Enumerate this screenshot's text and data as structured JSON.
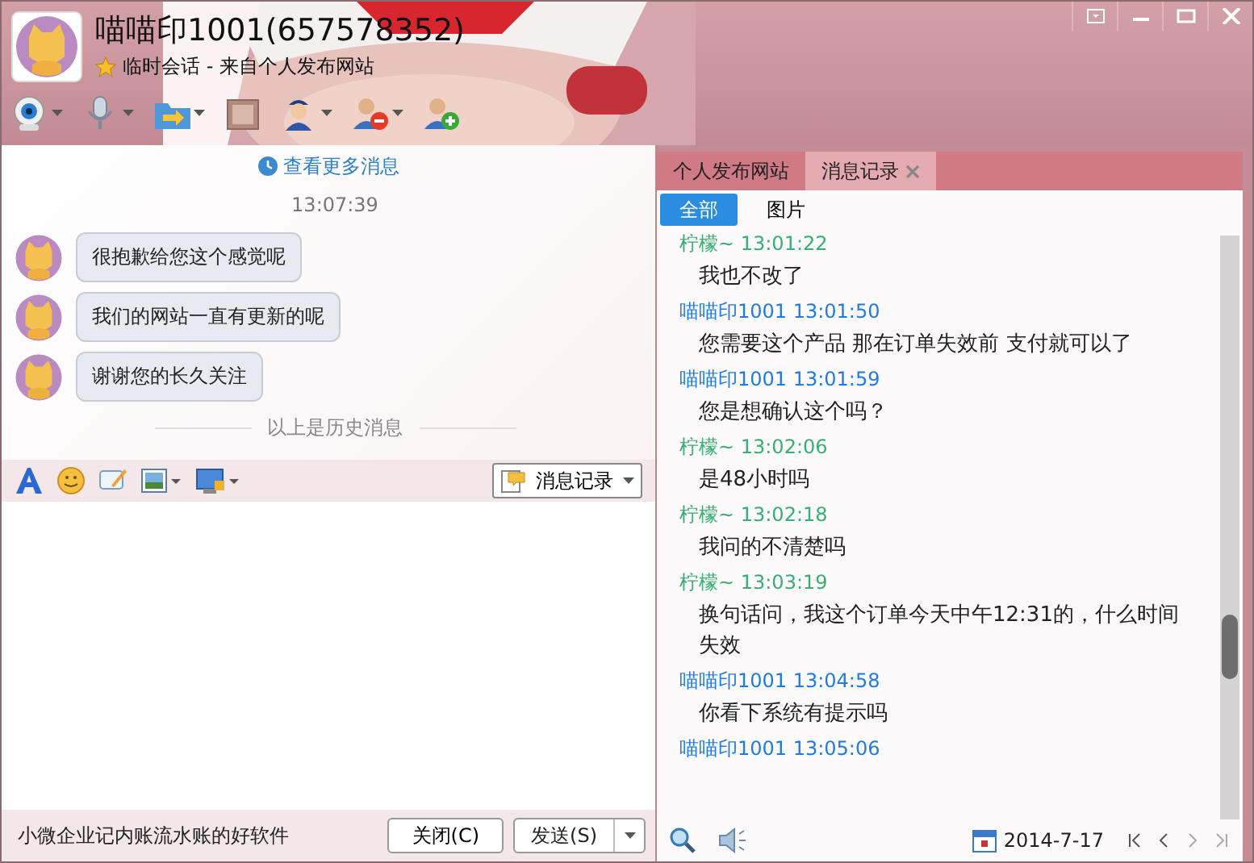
{
  "window": {
    "title": "喵喵印1001(657578352)",
    "subtitle": "临时会话 - 来自个人发布网站"
  },
  "toolbar": [
    {
      "kind": "webcam",
      "dropdown": true
    },
    {
      "kind": "mic",
      "dropdown": true
    },
    {
      "kind": "folder",
      "dropdown": true
    },
    {
      "kind": "mail",
      "dropdown": false
    },
    {
      "kind": "officer",
      "dropdown": true
    },
    {
      "kind": "remove-user",
      "dropdown": true
    },
    {
      "kind": "add-user",
      "dropdown": false
    }
  ],
  "chat": {
    "more_link": "查看更多消息",
    "time": "13:07:39",
    "messages": [
      "很抱歉给您这个感觉呢",
      "我们的网站一直有更新的呢",
      "谢谢您的长久关注"
    ],
    "history_divider": "以上是历史消息"
  },
  "input_toolbar": {
    "history_button": "消息记录"
  },
  "footer": {
    "ad": "小微企业记内账流水账的好软件",
    "buttons": [
      "关闭(C)",
      "发送(S)"
    ]
  },
  "side_tabs": [
    {
      "label": "个人发布网站",
      "selected": false
    },
    {
      "label": "消息记录",
      "selected": true
    }
  ],
  "filters": [
    {
      "label": "全部",
      "selected": true
    },
    {
      "label": "图片",
      "selected": false
    }
  ],
  "history": [
    {
      "sender": "柠檬~",
      "time": "13:01:22",
      "color": "#3aae74",
      "text": "我也不改了"
    },
    {
      "sender": "喵喵印1001",
      "time": "13:01:50",
      "color": "#1e7be6",
      "text": "您需要这个产品 那在订单失效前 支付就可以了"
    },
    {
      "sender": "喵喵印1001",
      "time": "13:01:59",
      "color": "#1e7be6",
      "text": "您是想确认这个吗？"
    },
    {
      "sender": "柠檬~",
      "time": "13:02:06",
      "color": "#3aae74",
      "text": "是48小时吗"
    },
    {
      "sender": "柠檬~",
      "time": "13:02:18",
      "color": "#3aae74",
      "text": "我问的不清楚吗"
    },
    {
      "sender": "柠檬~",
      "time": "13:03:19",
      "color": "#3aae74",
      "text": "换句话问，我这个订单今天中午12:31的，什么时间失效"
    },
    {
      "sender": "喵喵印1001",
      "time": "13:04:58",
      "color": "#1e7be6",
      "text": "你看下系统有提示吗"
    },
    {
      "sender": "喵喵印1001",
      "time": "13:05:06",
      "color": "#1e7be6"
    }
  ],
  "date": "2014-7-17"
}
